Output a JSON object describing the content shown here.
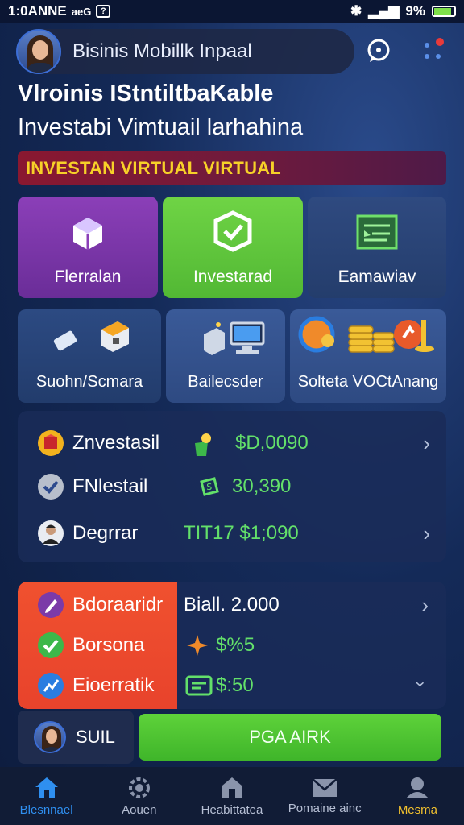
{
  "status_bar": {
    "time": "1:0ANNE",
    "carrier": "aeG",
    "battery": "9%"
  },
  "header": {
    "name": "Bisinis Mobillk Inpaal",
    "avatar": "profile-photo"
  },
  "title": {
    "line1": "Vlroinis IStntiltbaKable",
    "line2": "Investabi Vimtuail larhahina"
  },
  "banner": "INVESTAN VIRTUAL VIRTUAL",
  "tiles_row1": [
    {
      "label": "Flerralan",
      "color": "#7b3aa8",
      "icon": "cube-icon"
    },
    {
      "label": "Investarad",
      "color": "#62c73b",
      "icon": "shield-check-icon"
    },
    {
      "label": "Eamawiav",
      "color": "#283d6e",
      "icon": "document-icon"
    }
  ],
  "tiles_row2": [
    {
      "label": "Suohn/Scmara",
      "icon": "pipe-icon"
    },
    {
      "label": "Bailecsder",
      "icon": "computer-icon"
    },
    {
      "label": "Solteta VOCtAnang",
      "icon": "coins-icon"
    }
  ],
  "list1": [
    {
      "name": "Znvestasil",
      "value": "$D,0090",
      "icon": "box-icon"
    },
    {
      "name": "FNlestail",
      "value": "30,390",
      "icon": "check-icon"
    },
    {
      "name": "Degrrar",
      "value": "TIT17 $1;090",
      "icon": "person-icon"
    }
  ],
  "list2": [
    {
      "name": "Bdoraaridr",
      "value": "Biall. 2.000",
      "icon": "edit-icon"
    },
    {
      "name": "Borsona",
      "value": "$%5",
      "icon": "check-icon"
    },
    {
      "name": "Eioerratik",
      "value": "$:50",
      "icon": "chart-icon"
    }
  ],
  "user": {
    "name": "SUIL"
  },
  "cta": "PGA AIRK",
  "nav": [
    {
      "label": "Blesnnael",
      "icon": "home-icon",
      "color": "#2f8ff0"
    },
    {
      "label": "Aouen",
      "icon": "gear-icon",
      "color": "#b6bfd4"
    },
    {
      "label": "Heabittatea",
      "icon": "house-icon",
      "color": "#b6bfd4"
    },
    {
      "label": "Pomaine ainc",
      "icon": "mail-icon",
      "color": "#b6bfd4"
    },
    {
      "label": "Mesma",
      "icon": "user-icon",
      "color": "#f2c12e"
    }
  ]
}
